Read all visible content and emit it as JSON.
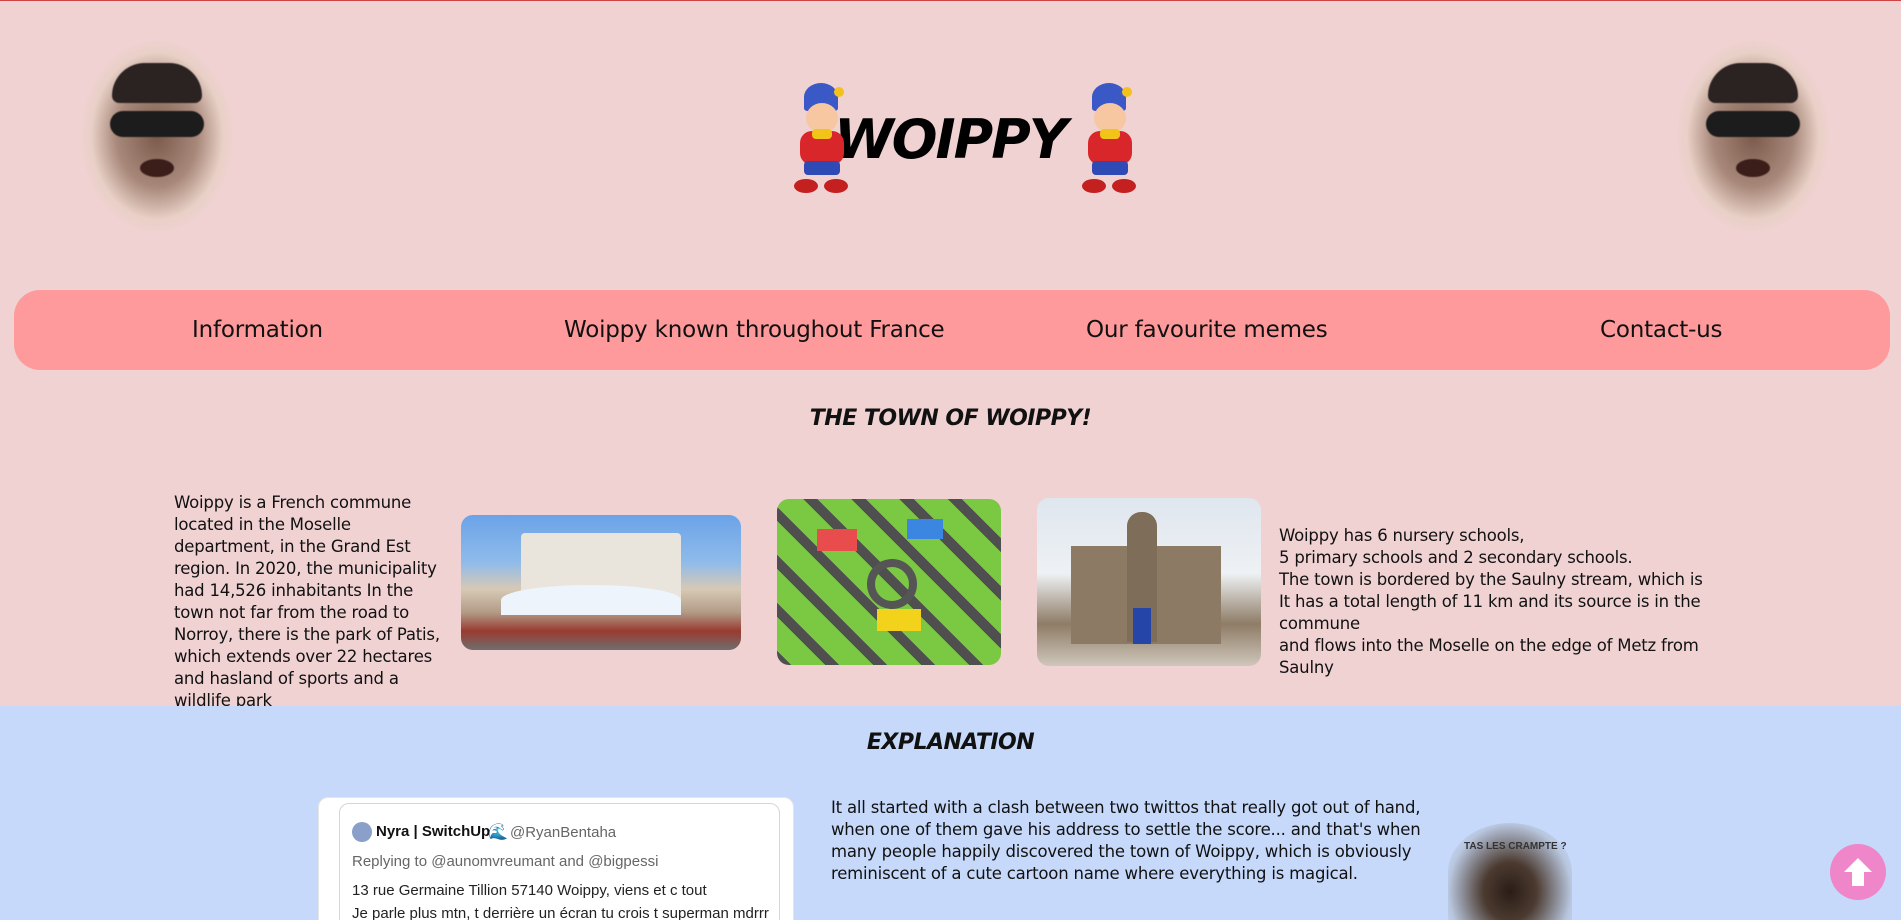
{
  "header": {
    "title": "WOIPPY",
    "avatar_left_icon": "portrait-photo",
    "avatar_right_icon": "portrait-photo",
    "mascot_icon": "noddy-cartoon-icon"
  },
  "nav": {
    "items": [
      {
        "label": "Information"
      },
      {
        "label": "Woippy known throughout France"
      },
      {
        "label": "Our favourite memes"
      },
      {
        "label": "Contact-us"
      }
    ]
  },
  "town": {
    "title": "THE TOWN OF WOIPPY!",
    "left_text": "Woippy is a French commune located in the Moselle department, in the Grand Est region. In 2020, the municipality had 14,526 inhabitants In the town not far from the road to Norroy, there is the park of Patis, which extends over 22 hectares and hasland of sports and a wildlife park",
    "right_lines": [
      "Woippy has 6 nursery schools,",
      "5 primary schools and 2 secondary schools.",
      "The town is bordered by the Saulny stream, which is",
      "It has a total length of 11 km and its source is in the commune",
      "and flows into the Moselle on the edge of Metz from Saulny"
    ]
  },
  "explanation": {
    "title": "EXPLANATION",
    "tweet": {
      "name": "Nyra | SwitchUp",
      "wave": "🌊",
      "handle": "@RyanBentaha",
      "replying": "Replying to @aunomvreumant and @bigpessi",
      "line1": "13 rue Germaine Tillion 57140 Woippy, viens et c tout",
      "line2": "Je parle plus mtn, t derrière un écran tu crois t superman mdrrr"
    },
    "text": "It all started with a clash between two twittos that really got out of hand, when one of them gave his address to settle the score... and that's when many people happily discovered the town of Woippy, which is obviously reminiscent of a cute cartoon name where everything is magical.",
    "photo_caption": "TAS LES CRAMPTE ?"
  },
  "colors": {
    "background": "#f0d2d3",
    "nav": "#fe9a9b",
    "explanation_band": "#c6d9fb",
    "scroll_button": "#ee86c9"
  }
}
